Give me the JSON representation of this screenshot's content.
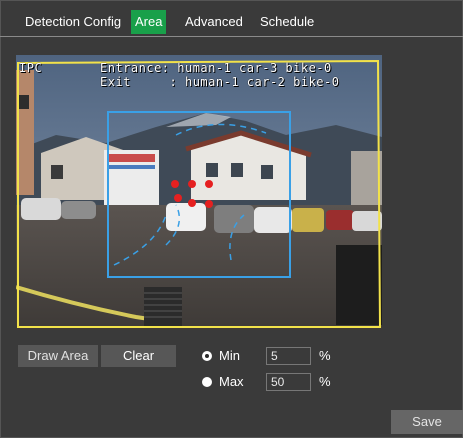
{
  "tabs": [
    {
      "label": "Detection Config"
    },
    {
      "label": "Area"
    },
    {
      "label": "Advanced"
    },
    {
      "label": "Schedule"
    }
  ],
  "active_tab": "Area",
  "video": {
    "osd_brand": "IPC",
    "osd_entrance": "Entrance: human-1 car-3 bike-0",
    "osd_exit": "Exit     : human-1 car-2 bike-0",
    "colors": {
      "outer_region": "#f2e24a",
      "detection_area": "#3aa0e6",
      "markers": "#e52020"
    }
  },
  "buttons": {
    "draw_area": "Draw Area",
    "clear": "Clear",
    "save": "Save"
  },
  "size_filter": {
    "min_label": "Min",
    "min_value": "5",
    "max_label": "Max",
    "max_value": "50",
    "unit": "%",
    "selected": "Min"
  },
  "accent": "#19a04a"
}
